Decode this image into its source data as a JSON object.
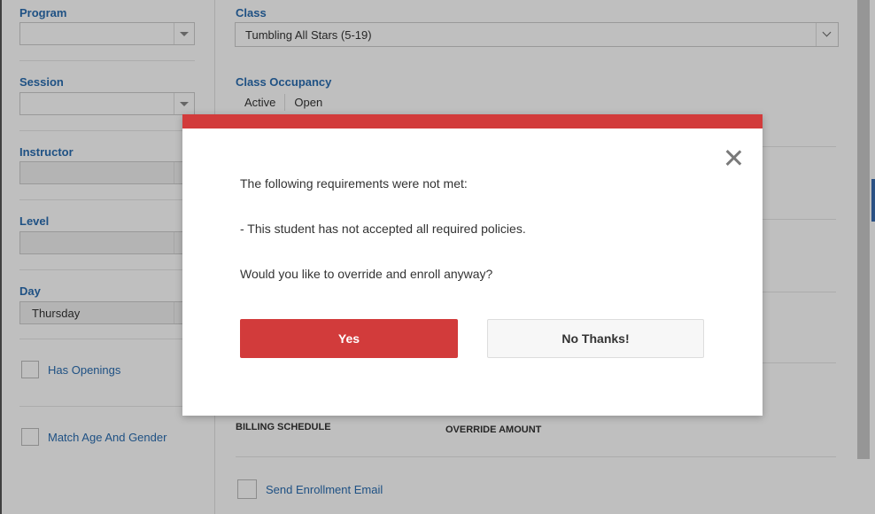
{
  "filters": {
    "program_label": "Program",
    "program_value": "",
    "session_label": "Session",
    "session_value": "",
    "instructor_label": "Instructor",
    "instructor_value": "",
    "level_label": "Level",
    "level_value": "",
    "day_label": "Day",
    "day_value": "Thursday",
    "has_openings_label": "Has Openings",
    "match_age_gender_label": "Match Age And Gender"
  },
  "main": {
    "class_label": "Class",
    "class_value": "Tumbling All Stars (5-19)",
    "occupancy_label": "Class Occupancy",
    "occupancy_columns": [
      "Active",
      "Open"
    ],
    "billing_schedule_label": "BILLING SCHEDULE",
    "override_amount_label": "OVERRIDE AMOUNT",
    "send_email_label": "Send Enrollment Email"
  },
  "modal": {
    "line1": "The following requirements were not met:",
    "line2": "- This student has not accepted all required policies.",
    "line3": "Would you like to override and enroll anyway?",
    "yes_label": "Yes",
    "no_label": "No Thanks!",
    "accent_color": "#d23b3b"
  }
}
